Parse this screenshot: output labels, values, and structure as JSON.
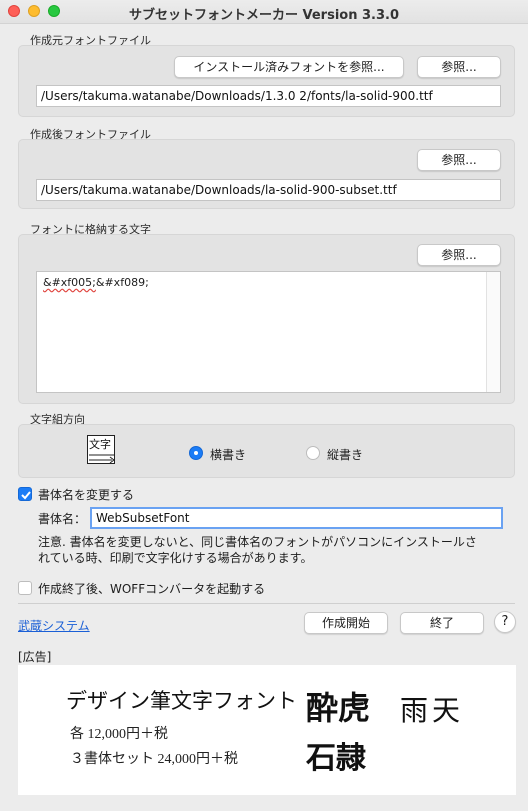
{
  "window": {
    "title": "サブセットフォントメーカー Version 3.3.0"
  },
  "source_font": {
    "section_label": "作成元フォントファイル",
    "installed_button": "インストール済みフォントを参照...",
    "browse_button": "参照...",
    "path": "/Users/takuma.watanabe/Downloads/1.3.0 2/fonts/la-solid-900.ttf"
  },
  "output_font": {
    "section_label": "作成後フォントファイル",
    "browse_button": "参照...",
    "path": "/Users/takuma.watanabe/Downloads/la-solid-900-subset.ttf"
  },
  "characters": {
    "section_label": "フォントに格納する文字",
    "browse_button": "参照...",
    "content_part1": "&#xf005;",
    "content_part2": "&#xf089;"
  },
  "direction": {
    "section_label": "文字組方向",
    "icon_text": "文字",
    "horizontal_label": "横書き",
    "vertical_label": "縦書き",
    "selected": "horizontal"
  },
  "rename": {
    "checkbox_label": "書体名を変更する",
    "checked": true,
    "name_label": "書体名：",
    "name_value": "WebSubsetFont",
    "note_line1": "注意. 書体名を変更しないと、同じ書体名のフォントがパソコンにインストールさ",
    "note_line2": "れている時、印刷で文字化けする場合があります。"
  },
  "woff": {
    "checkbox_label": "作成終了後、WOFFコンバータを起動する",
    "checked": false
  },
  "footer": {
    "link": "武蔵システム",
    "start_button": "作成開始",
    "quit_button": "終了",
    "help_button": "?"
  },
  "ad": {
    "label": "[広告]",
    "headline": "デザイン筆文字フォント",
    "price1": "各 12,000円＋税",
    "price2": "３書体セット 24,000円＋税",
    "calli1": "酔虎",
    "calli2": "雨天",
    "calli3": "石隷"
  },
  "colors": {
    "accent": "#1b7cf6",
    "link": "#1a5fd6"
  }
}
